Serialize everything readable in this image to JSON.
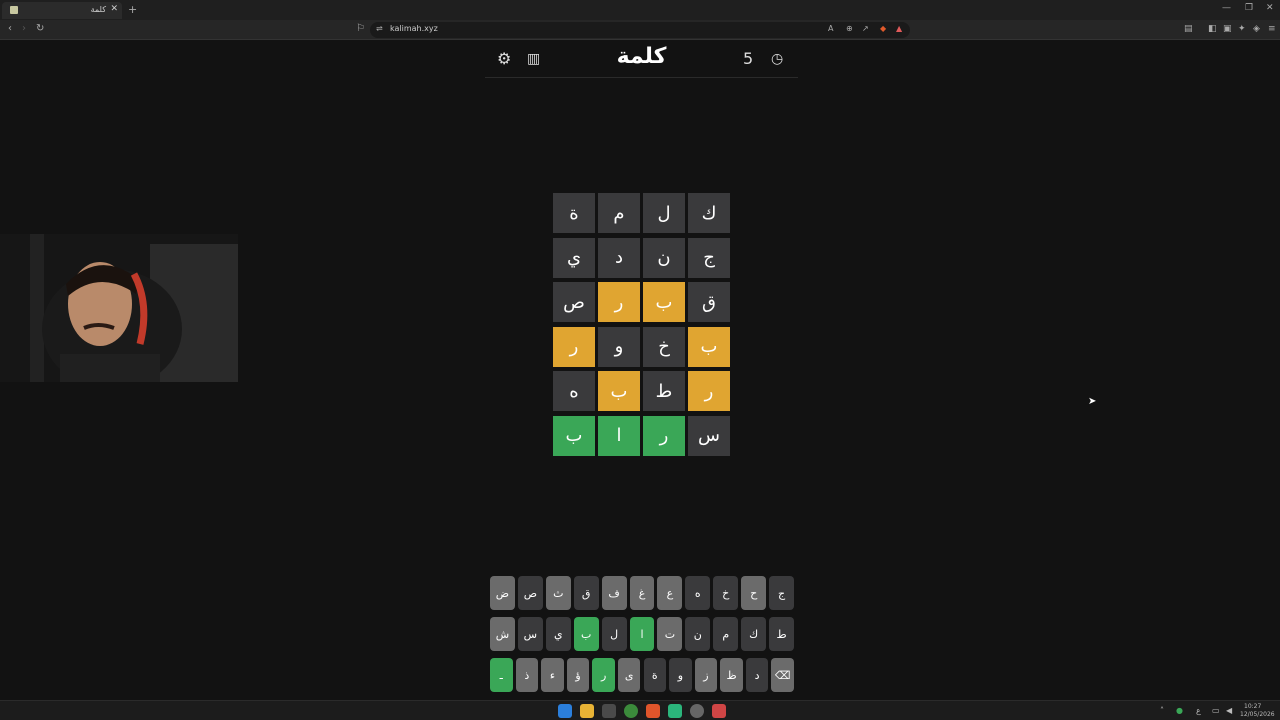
{
  "browser": {
    "tab_title": "كلمة",
    "tab_close": "✕",
    "new_tab": "+",
    "url": "kalimah.xyz"
  },
  "game": {
    "title": "كلمة",
    "count": "5",
    "board": [
      [
        {
          "l": "ة",
          "s": "absent"
        },
        {
          "l": "م",
          "s": "absent"
        },
        {
          "l": "ل",
          "s": "absent"
        },
        {
          "l": "ك",
          "s": "absent"
        }
      ],
      [
        {
          "l": "ي",
          "s": "absent"
        },
        {
          "l": "د",
          "s": "absent"
        },
        {
          "l": "ن",
          "s": "absent"
        },
        {
          "l": "ج",
          "s": "absent"
        }
      ],
      [
        {
          "l": "ص",
          "s": "absent"
        },
        {
          "l": "ر",
          "s": "present"
        },
        {
          "l": "ب",
          "s": "present"
        },
        {
          "l": "ق",
          "s": "absent"
        }
      ],
      [
        {
          "l": "ر",
          "s": "present"
        },
        {
          "l": "و",
          "s": "absent"
        },
        {
          "l": "خ",
          "s": "absent"
        },
        {
          "l": "ب",
          "s": "present"
        }
      ],
      [
        {
          "l": "ه",
          "s": "absent"
        },
        {
          "l": "ب",
          "s": "present"
        },
        {
          "l": "ط",
          "s": "absent"
        },
        {
          "l": "ر",
          "s": "present"
        }
      ],
      [
        {
          "l": "ب",
          "s": "correct"
        },
        {
          "l": "ا",
          "s": "correct"
        },
        {
          "l": "ر",
          "s": "correct"
        },
        {
          "l": "س",
          "s": "absent"
        }
      ]
    ],
    "keyboard": [
      [
        {
          "k": "ض",
          "s": "unused"
        },
        {
          "k": "ص",
          "s": "absent"
        },
        {
          "k": "ث",
          "s": "unused"
        },
        {
          "k": "ق",
          "s": "absent"
        },
        {
          "k": "ف",
          "s": "unused"
        },
        {
          "k": "غ",
          "s": "unused"
        },
        {
          "k": "ع",
          "s": "unused"
        },
        {
          "k": "ه",
          "s": "absent"
        },
        {
          "k": "خ",
          "s": "absent"
        },
        {
          "k": "ح",
          "s": "unused"
        },
        {
          "k": "ج",
          "s": "absent"
        }
      ],
      [
        {
          "k": "ش",
          "s": "unused"
        },
        {
          "k": "س",
          "s": "absent"
        },
        {
          "k": "ي",
          "s": "absent"
        },
        {
          "k": "ب",
          "s": "correct"
        },
        {
          "k": "ل",
          "s": "absent"
        },
        {
          "k": "ا",
          "s": "correct"
        },
        {
          "k": "ت",
          "s": "unused"
        },
        {
          "k": "ن",
          "s": "absent"
        },
        {
          "k": "م",
          "s": "absent"
        },
        {
          "k": "ك",
          "s": "absent"
        },
        {
          "k": "ط",
          "s": "absent"
        }
      ],
      [
        {
          "k": "ـ",
          "s": "correct"
        },
        {
          "k": "ذ",
          "s": "unused"
        },
        {
          "k": "ء",
          "s": "unused"
        },
        {
          "k": "ؤ",
          "s": "unused"
        },
        {
          "k": "ر",
          "s": "correct"
        },
        {
          "k": "ى",
          "s": "unused"
        },
        {
          "k": "ة",
          "s": "absent"
        },
        {
          "k": "و",
          "s": "absent"
        },
        {
          "k": "ز",
          "s": "unused"
        },
        {
          "k": "ظ",
          "s": "unused"
        },
        {
          "k": "د",
          "s": "absent"
        },
        {
          "k": "⌫",
          "s": "unused"
        }
      ]
    ]
  },
  "colors": {
    "correct": "#3aa757",
    "present": "#e0a531",
    "absent": "#3a3a3c",
    "unused": "#6b6b6b",
    "background": "#121212"
  },
  "taskbar": {
    "time": "10:27",
    "date": "12/05/2026",
    "lang": "ع"
  }
}
